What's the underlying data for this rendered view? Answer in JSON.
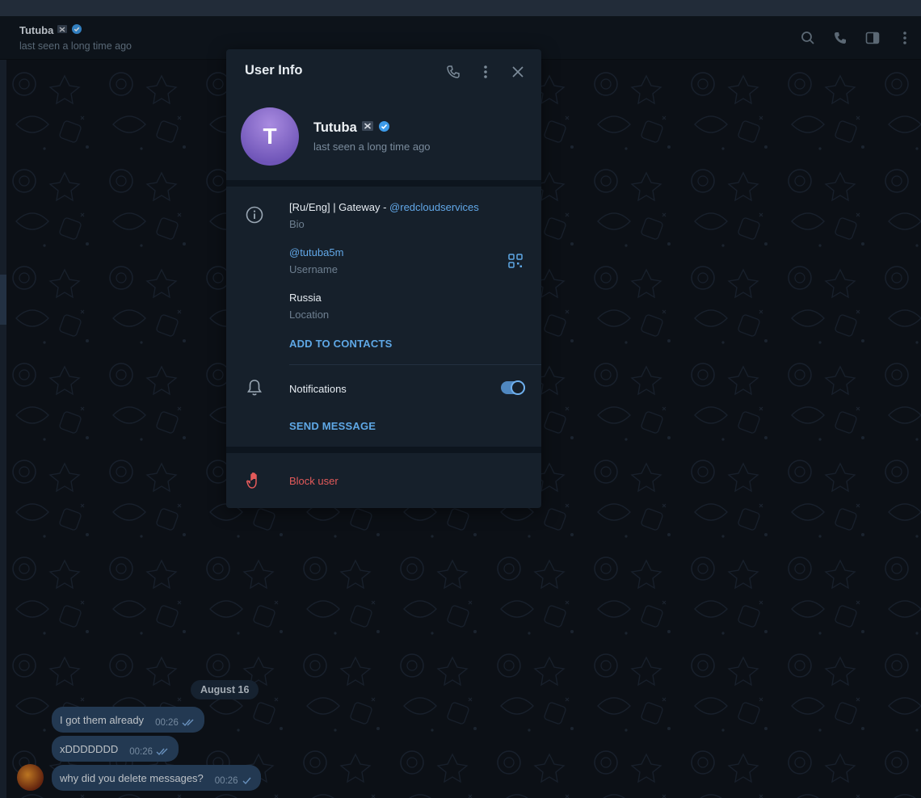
{
  "chat_header": {
    "name": "Tutuba",
    "status": "last seen a long time ago"
  },
  "chat": {
    "date_label": "August 16",
    "messages": [
      {
        "text": "I got them already",
        "time": "00:26"
      },
      {
        "text": "xDDDDDDD",
        "time": "00:26"
      },
      {
        "text": "why did you delete messages?",
        "time": "00:26"
      }
    ]
  },
  "panel": {
    "title": "User Info",
    "profile": {
      "initial": "T",
      "name": "Tutuba",
      "status": "last seen a long time ago"
    },
    "bio": {
      "text_prefix": "[Ru/Eng] | Gateway - ",
      "text_link": "@redcloudservices",
      "label": "Bio"
    },
    "username": {
      "value": "@tutuba5m",
      "label": "Username"
    },
    "location": {
      "value": "Russia",
      "label": "Location"
    },
    "add_to_contacts": "ADD TO CONTACTS",
    "notifications": {
      "label": "Notifications",
      "enabled": true
    },
    "send_message": "SEND MESSAGE",
    "block_user": "Block user"
  },
  "colors": {
    "accent": "#5fa8e6",
    "danger": "#e35a5a",
    "bubble": "#2b4664",
    "panel_bg": "#16202b"
  },
  "icons": {
    "header": [
      "search-icon",
      "phone-icon",
      "sidebar-toggle-icon",
      "more-vertical-icon"
    ],
    "panel_top": [
      "phone-icon",
      "more-vertical-icon",
      "close-icon"
    ],
    "rows": [
      "info-icon",
      "qr-code-icon",
      "bell-icon",
      "hand-stop-icon"
    ]
  }
}
